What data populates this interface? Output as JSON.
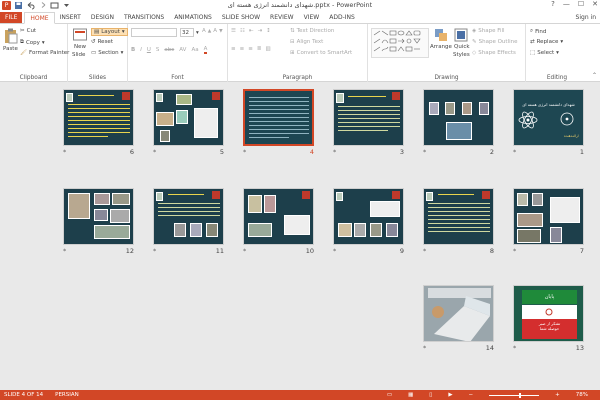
{
  "window": {
    "title": "شهدای دانشمند انرژی هسته ای.pptx - PowerPoint",
    "controls": [
      "?",
      "—",
      "☐",
      "✕"
    ]
  },
  "tabs": [
    "FILE",
    "HOME",
    "INSERT",
    "DESIGN",
    "TRANSITIONS",
    "ANIMATIONS",
    "SLIDE SHOW",
    "REVIEW",
    "VIEW",
    "ADD-INS"
  ],
  "signin": "Sign in",
  "ribbon": {
    "clipboard": {
      "label": "Clipboard",
      "paste": "Paste",
      "cut": "Cut",
      "copy": "Copy",
      "painter": "Format Painter"
    },
    "slides": {
      "label": "Slides",
      "new_slide": "New",
      "new_slide2": "Slide",
      "layout": "Layout",
      "reset": "Reset",
      "section": "Section"
    },
    "font": {
      "label": "Font",
      "size": "32",
      "buttons": [
        "B",
        "I",
        "U",
        "S",
        "abc",
        "AV",
        "Aa",
        "A"
      ]
    },
    "paragraph": {
      "label": "Paragraph",
      "text_direction": "Text Direction",
      "align_text": "Align Text",
      "smartart": "Convert to SmartArt"
    },
    "drawing": {
      "label": "Drawing",
      "arrange": "Arrange",
      "quick_styles": "Quick",
      "quick_styles2": "Styles",
      "shape_fill": "Shape Fill",
      "shape_outline": "Shape Outline",
      "shape_effects": "Shape Effects"
    },
    "editing": {
      "label": "Editing",
      "find": "Find",
      "replace": "Replace",
      "select": "Select"
    }
  },
  "slides": [
    {
      "num": "1",
      "star": "*"
    },
    {
      "num": "2",
      "star": "*"
    },
    {
      "num": "3",
      "star": "*"
    },
    {
      "num": "4",
      "star": "*"
    },
    {
      "num": "5",
      "star": "*"
    },
    {
      "num": "6",
      "star": "*"
    },
    {
      "num": "7",
      "star": "*"
    },
    {
      "num": "8",
      "star": "*"
    },
    {
      "num": "9",
      "star": "*"
    },
    {
      "num": "10",
      "star": "*"
    },
    {
      "num": "11",
      "star": "*"
    },
    {
      "num": "12",
      "star": "*"
    },
    {
      "num": "13",
      "star": "*"
    },
    {
      "num": "14",
      "star": "*"
    }
  ],
  "slide13": {
    "line1": "پایان",
    "line2": "تشکر از صبر",
    "line3": "حوصله شما"
  },
  "slide1": {
    "title": "شهدای دانشمند انرژی هسته ای",
    "subtitle": "ارائه‌دهنده"
  },
  "status": {
    "slide": "SLIDE 4 OF 14",
    "language": "PERSIAN",
    "zoom": "78%"
  },
  "colors": {
    "accent": "#d24726",
    "slide_bg": "#1d3f4b"
  }
}
